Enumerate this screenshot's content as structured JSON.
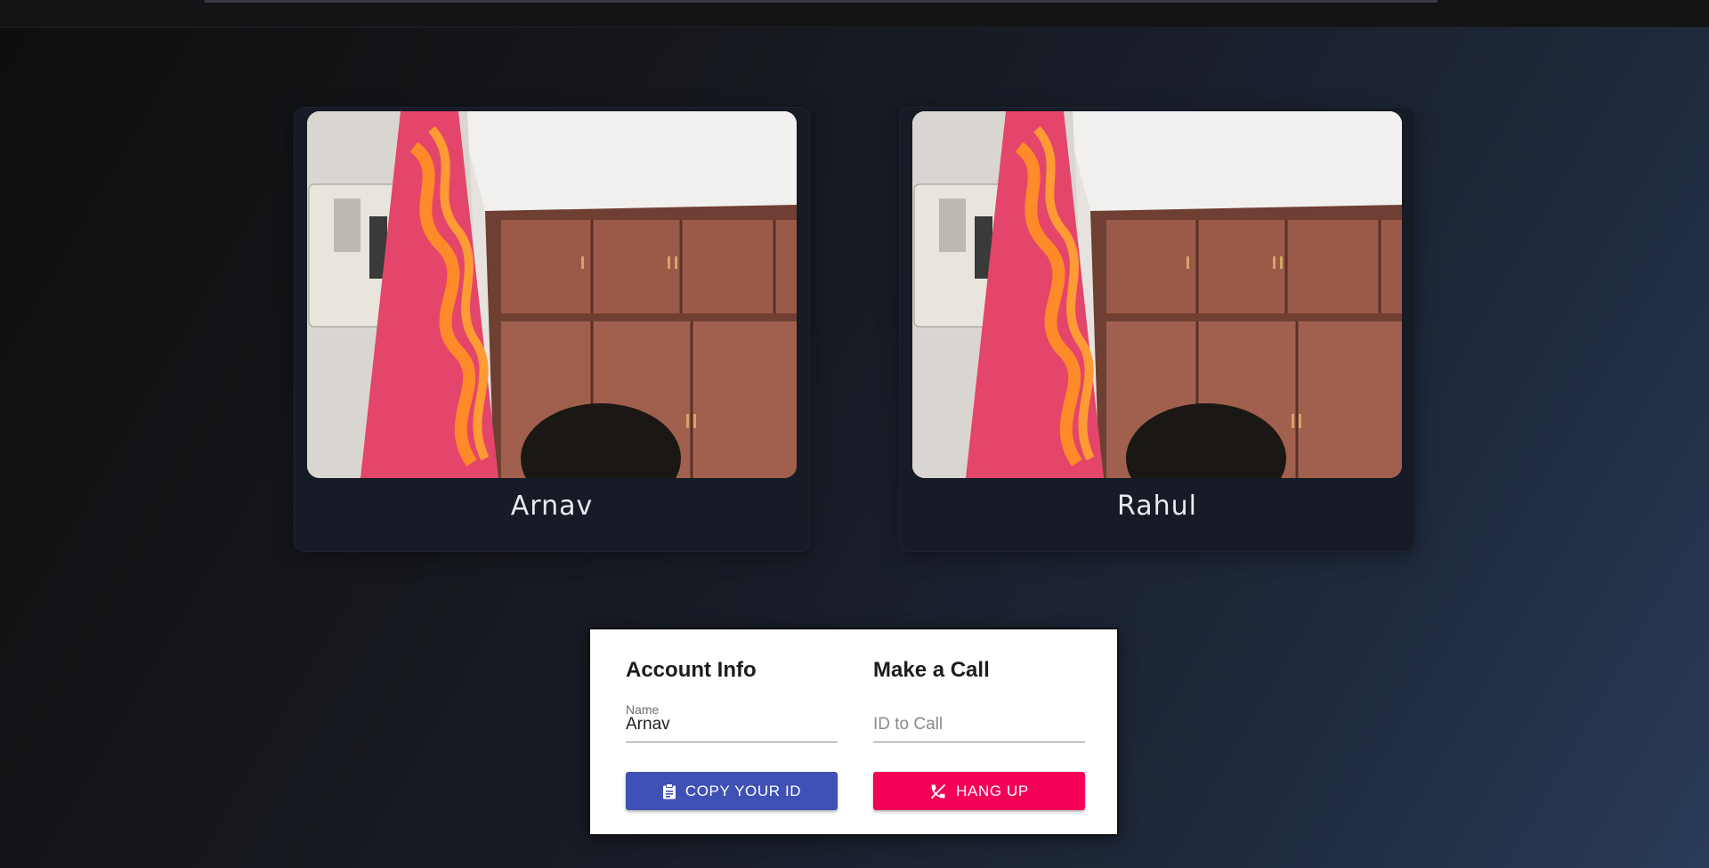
{
  "videos": [
    {
      "name": "Arnav"
    },
    {
      "name": "Rahul"
    }
  ],
  "account": {
    "title": "Account Info",
    "name_label": "Name",
    "name_value": "Arnav",
    "copy_button": "COPY YOUR ID",
    "copy_icon": "clipboard-icon"
  },
  "call": {
    "title": "Make a Call",
    "id_placeholder": "ID to Call",
    "id_value": "",
    "hangup_button": "HANG UP",
    "hangup_icon": "phone-disabled-icon"
  },
  "colors": {
    "primary": "#3f51b5",
    "secondary": "#f50057"
  }
}
